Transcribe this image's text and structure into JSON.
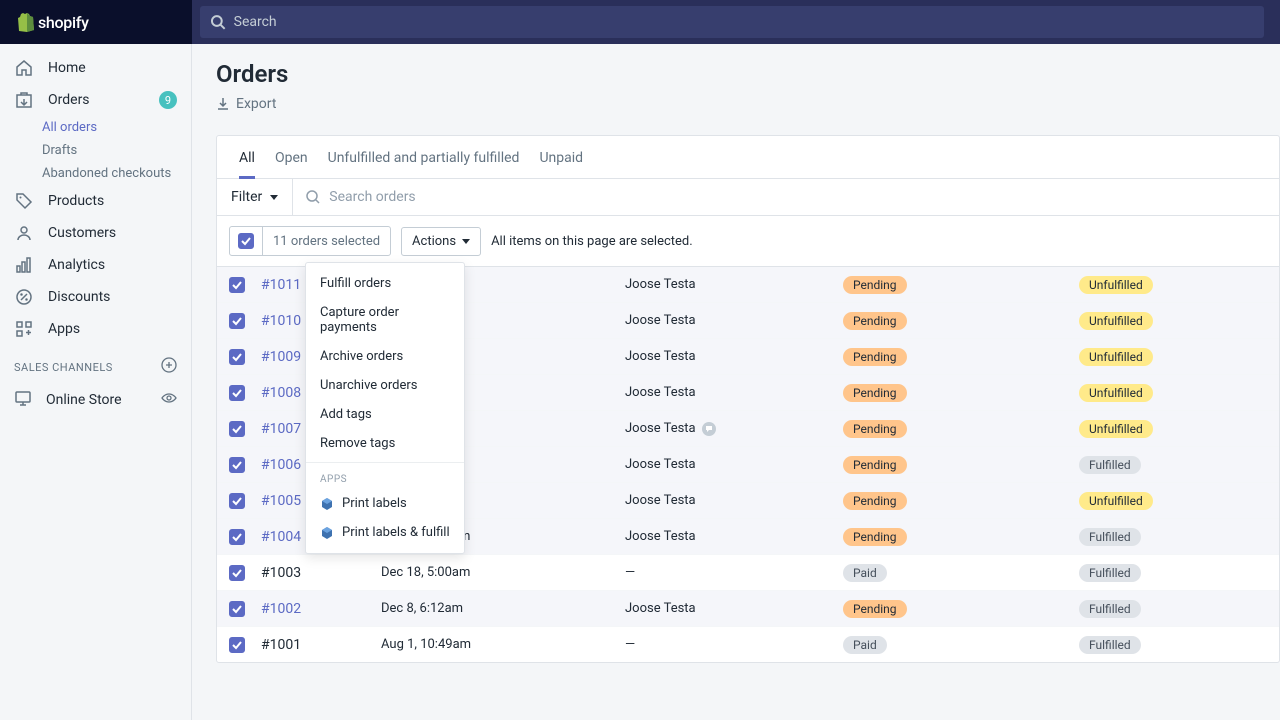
{
  "brand": "shopify",
  "search": {
    "placeholder": "Search"
  },
  "nav": {
    "home": "Home",
    "orders": "Orders",
    "orders_badge": "9",
    "all_orders": "All orders",
    "drafts": "Drafts",
    "abandoned": "Abandoned checkouts",
    "products": "Products",
    "customers": "Customers",
    "analytics": "Analytics",
    "discounts": "Discounts",
    "apps": "Apps",
    "channels_head": "SALES CHANNELS",
    "online_store": "Online Store"
  },
  "page": {
    "title": "Orders",
    "export": "Export"
  },
  "tabs": {
    "all": "All",
    "open": "Open",
    "unfulfilled": "Unfulfilled and partially fulfilled",
    "unpaid": "Unpaid"
  },
  "filter_label": "Filter",
  "search_orders_placeholder": "Search orders",
  "bulk": {
    "selected_text": "11 orders selected",
    "actions": "Actions",
    "all_selected_msg": "All items on this page are selected."
  },
  "dropdown": {
    "fulfill": "Fulfill orders",
    "capture": "Capture order payments",
    "archive": "Archive orders",
    "unarchive": "Unarchive orders",
    "add_tags": "Add tags",
    "remove_tags": "Remove tags",
    "apps_head": "APPS",
    "print_labels": "Print labels",
    "print_fulfill": "Print labels & fulfill"
  },
  "pills": {
    "pending": "Pending",
    "paid": "Paid",
    "unfulfilled": "Unfulfilled",
    "fulfilled": "Fulfilled"
  },
  "orders": [
    {
      "id": "#1011",
      "date": "",
      "cust": "Joose Testa",
      "pay": "pending",
      "ful": "unfulfilled",
      "link": true,
      "note": false
    },
    {
      "id": "#1010",
      "date": "",
      "cust": "Joose Testa",
      "pay": "pending",
      "ful": "unfulfilled",
      "link": true,
      "note": false
    },
    {
      "id": "#1009",
      "date": "",
      "cust": "Joose Testa",
      "pay": "pending",
      "ful": "unfulfilled",
      "link": true,
      "note": false
    },
    {
      "id": "#1008",
      "date": "",
      "cust": "Joose Testa",
      "pay": "pending",
      "ful": "unfulfilled",
      "link": true,
      "note": false
    },
    {
      "id": "#1007",
      "date": "",
      "cust": "Joose Testa",
      "pay": "pending",
      "ful": "unfulfilled",
      "link": true,
      "note": true
    },
    {
      "id": "#1006",
      "date": "",
      "cust": "Joose Testa",
      "pay": "pending",
      "ful": "fulfilled",
      "link": true,
      "note": false
    },
    {
      "id": "#1005",
      "date": "",
      "cust": "Joose Testa",
      "pay": "pending",
      "ful": "unfulfilled",
      "link": true,
      "note": false
    },
    {
      "id": "#1004",
      "date": "Dec 18, 5:02am",
      "cust": "Joose Testa",
      "pay": "pending",
      "ful": "fulfilled",
      "link": true,
      "note": false
    },
    {
      "id": "#1003",
      "date": "Dec 18, 5:00am",
      "cust": "—",
      "pay": "paid",
      "ful": "fulfilled",
      "link": false,
      "note": false
    },
    {
      "id": "#1002",
      "date": "Dec 8, 6:12am",
      "cust": "Joose Testa",
      "pay": "pending",
      "ful": "fulfilled",
      "link": true,
      "note": false
    },
    {
      "id": "#1001",
      "date": "Aug 1, 10:49am",
      "cust": "—",
      "pay": "paid",
      "ful": "fulfilled",
      "link": false,
      "note": false
    }
  ]
}
